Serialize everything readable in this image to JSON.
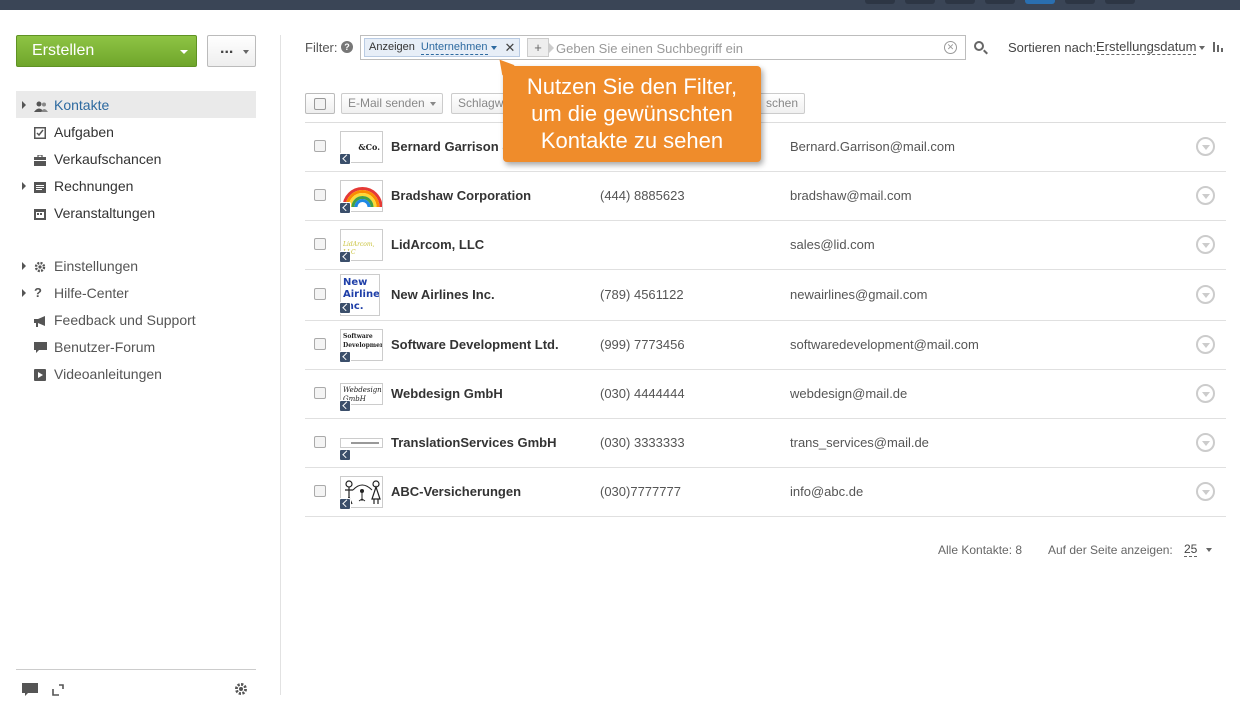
{
  "sidebar": {
    "create_label": "Erstellen",
    "more_label": "...",
    "items": [
      {
        "label": "Kontakte",
        "icon": "contacts-icon"
      },
      {
        "label": "Aufgaben",
        "icon": "tasks-icon"
      },
      {
        "label": "Verkaufschancen",
        "icon": "deals-icon"
      },
      {
        "label": "Rechnungen",
        "icon": "invoices-icon"
      },
      {
        "label": "Veranstaltungen",
        "icon": "events-icon"
      }
    ],
    "items2": [
      {
        "label": "Einstellungen",
        "icon": "gear-icon"
      },
      {
        "label": "Hilfe-Center",
        "icon": "question-icon"
      },
      {
        "label": "Feedback und Support",
        "icon": "megaphone-icon"
      },
      {
        "label": "Benutzer-Forum",
        "icon": "chat-icon"
      },
      {
        "label": "Videoanleitungen",
        "icon": "video-icon"
      }
    ]
  },
  "filter": {
    "label": "Filter:",
    "chip_prefix": "Anzeigen",
    "chip_value": "Unternehmen",
    "chip_close": "✕",
    "plus": "+",
    "placeholder": "Geben Sie einen Suchbegriff ein",
    "clear": "✕"
  },
  "sort": {
    "label": "Sortieren nach:",
    "value": "Erstellungsdatum"
  },
  "toolbar": {
    "email_label": "E-Mail senden",
    "tags_label": "Schlagw",
    "delete_label": "schen"
  },
  "tooltip": {
    "line1": "Nutzen Sie den Filter,",
    "line2": "um die gewünschten",
    "line3": "Kontakte zu sehen"
  },
  "contacts": [
    {
      "name": "Bernard Garrison &",
      "phone": "",
      "email": "Bernard.Garrison@mail.com",
      "logo": "&Co."
    },
    {
      "name": "Bradshaw Corporation",
      "phone": "(444) 8885623",
      "email": "bradshaw@mail.com",
      "logo": ""
    },
    {
      "name": "LidArcom, LLC",
      "phone": "",
      "email": "sales@lid.com",
      "logo": "LidArcom, LLC"
    },
    {
      "name": "New Airlines Inc.",
      "phone": "(789) 4561122",
      "email": "newairlines@gmail.com",
      "logo": "New Airlines Inc."
    },
    {
      "name": "Software Development Ltd.",
      "phone": "(999) 7773456",
      "email": "softwaredevelopment@mail.com",
      "logo": "Software Development"
    },
    {
      "name": "Webdesign GmbH",
      "phone": "(030) 4444444",
      "email": "webdesign@mail.de",
      "logo": "Webdesign GmbH"
    },
    {
      "name": "TranslationServices GmbH",
      "phone": "(030) 3333333",
      "email": "trans_services@mail.de",
      "logo": ""
    },
    {
      "name": "ABC-Versicherungen",
      "phone": "(030)7777777",
      "email": "info@abc.de",
      "logo": ""
    }
  ],
  "footer": {
    "total": "Alle Kontakte: 8",
    "per_page_label": "Auf der Seite anzeigen:",
    "per_page_value": "25"
  },
  "colors": {
    "accent": "#6fa52b",
    "tooltip": "#ef8c2b",
    "link": "#2d6aa0"
  }
}
